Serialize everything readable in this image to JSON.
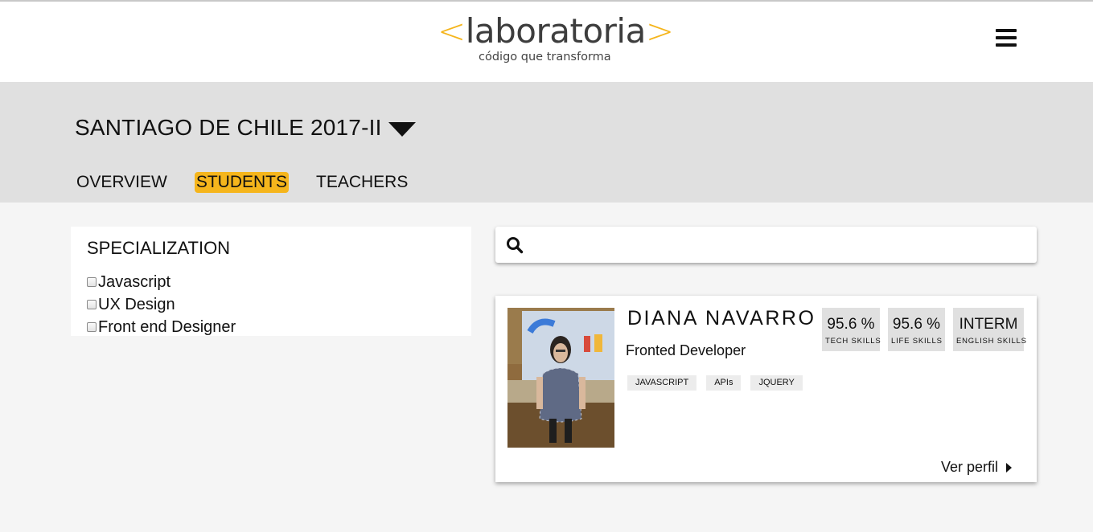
{
  "header": {
    "logo_prefix": "<",
    "logo_word": "laboratoria",
    "logo_suffix": ">",
    "tagline": "código que transforma",
    "menu_icon": "hamburger-menu-icon"
  },
  "cohort": {
    "title": "SANTIAGO DE CHILE 2017-II",
    "dropdown_icon": "caret-down-icon"
  },
  "tabs": [
    {
      "label": "OVERVIEW",
      "active": false
    },
    {
      "label": "STUDENTS",
      "active": true
    },
    {
      "label": "TEACHERS",
      "active": false
    }
  ],
  "filters": {
    "title": "SPECIALIZATION",
    "options": [
      {
        "label": "Javascript",
        "checked": false
      },
      {
        "label": "UX Design",
        "checked": false
      },
      {
        "label": "Front end Designer",
        "checked": false
      }
    ]
  },
  "search": {
    "icon": "search-icon",
    "placeholder": "",
    "value": ""
  },
  "students": [
    {
      "name": "DIANA NAVARRO",
      "role": "Fronted Developer",
      "tags": [
        "JAVASCRIPT",
        "APIs",
        "JQUERY"
      ],
      "stats": [
        {
          "value": "95.6 %",
          "label": "TECH SKILLS"
        },
        {
          "value": "95.6 %",
          "label": "LIFE SKILLS"
        },
        {
          "value": "INTERM",
          "label": "ENGLISH SKILLS"
        }
      ],
      "profile_link": "Ver perfil"
    }
  ],
  "colors": {
    "accent": "#f5b51c",
    "band": "#e0e0e0",
    "page": "#f5f5f5",
    "card": "#ffffff",
    "stat_box": "#e0e0e0",
    "tag_bg": "#ececec"
  }
}
